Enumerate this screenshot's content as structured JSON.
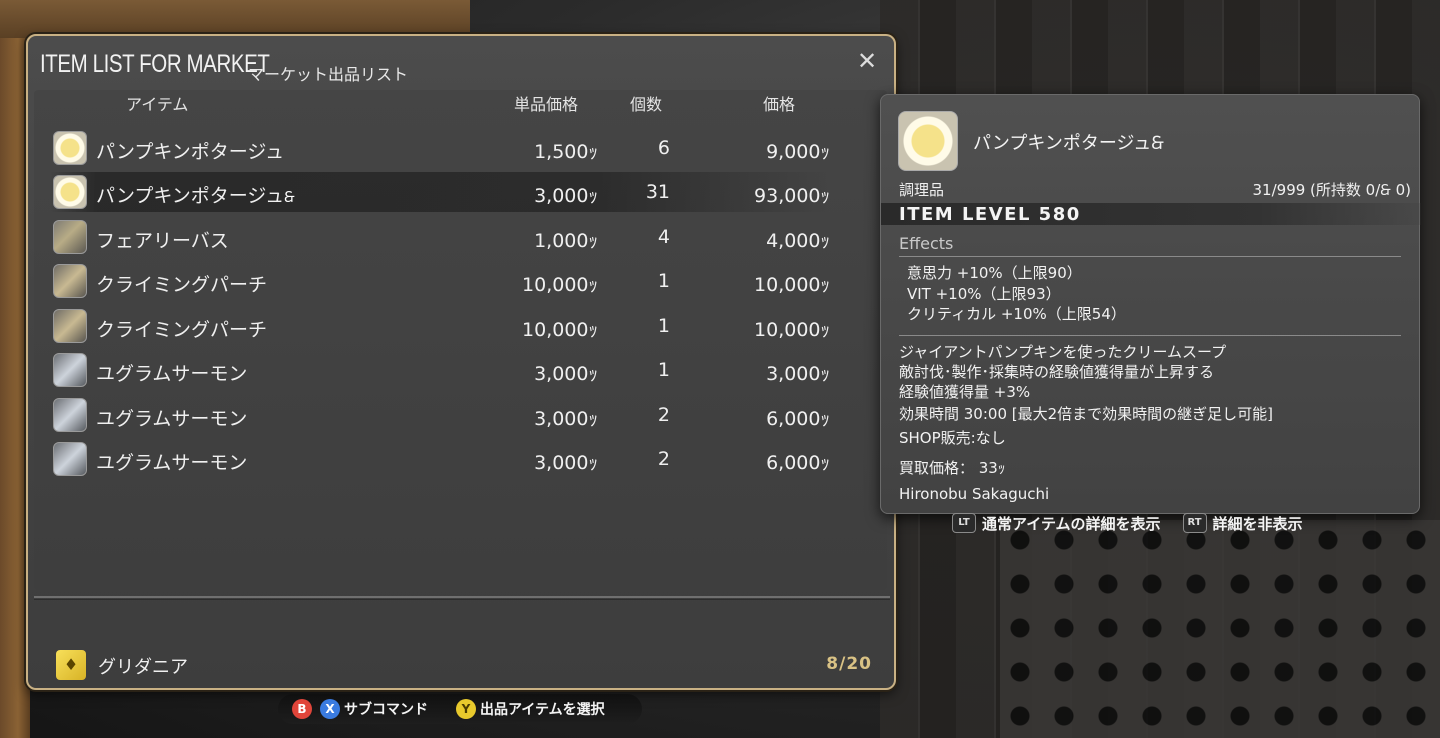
{
  "window": {
    "title_en": "ITEM LIST FOR MARKET",
    "title_jp": "マーケット出品リスト",
    "close_glyph": "✕"
  },
  "columns": {
    "item": "アイテム",
    "unit_price": "単品価格",
    "quantity": "個数",
    "price": "価格"
  },
  "items": [
    {
      "name": "パンプキンポタージュ",
      "hq": "",
      "unit_price": "1,500ｯ",
      "quantity": "6",
      "price": "9,000ｯ",
      "icon": "soup-icon"
    },
    {
      "name": "パンプキンポタージュ",
      "hq": "🙲",
      "unit_price": "3,000ｯ",
      "quantity": "31",
      "price": "93,000ｯ",
      "icon": "soup-icon"
    },
    {
      "name": "フェアリーバス",
      "hq": "",
      "unit_price": "1,000ｯ",
      "quantity": "4",
      "price": "4,000ｯ",
      "icon": "fish-icon"
    },
    {
      "name": "クライミングパーチ",
      "hq": "",
      "unit_price": "10,000ｯ",
      "quantity": "1",
      "price": "10,000ｯ",
      "icon": "fish-icon"
    },
    {
      "name": "クライミングパーチ",
      "hq": "",
      "unit_price": "10,000ｯ",
      "quantity": "1",
      "price": "10,000ｯ",
      "icon": "fish-icon"
    },
    {
      "name": "ユグラムサーモン",
      "hq": "",
      "unit_price": "3,000ｯ",
      "quantity": "1",
      "price": "3,000ｯ",
      "icon": "fish-icon"
    },
    {
      "name": "ユグラムサーモン",
      "hq": "",
      "unit_price": "3,000ｯ",
      "quantity": "2",
      "price": "6,000ｯ",
      "icon": "fish-icon"
    },
    {
      "name": "ユグラムサーモン",
      "hq": "",
      "unit_price": "3,000ｯ",
      "quantity": "2",
      "price": "6,000ｯ",
      "icon": "fish-icon"
    }
  ],
  "footer": {
    "city": "グリダニア",
    "capacity": "8/20"
  },
  "hints": {
    "b_key": "B",
    "x_key": "X",
    "subcommand": "サブコマンド",
    "y_key": "Y",
    "select_item": "出品アイテムを選択"
  },
  "tooltip": {
    "name": "パンプキンポタージュ",
    "hq": "🙲",
    "category": "調理品",
    "count": "31/999 (所持数 0/🙲 0)",
    "item_level": "ITEM LEVEL 580",
    "effects_title": "Effects",
    "effects": [
      "意思力 +10%（上限90）",
      "VIT +10%（上限93）",
      "クリティカル +10%（上限54）"
    ],
    "description": [
      "ジャイアントパンプキンを使ったクリームスープ",
      "敵討伐･製作･採集時の経験値獲得量が上昇する",
      "経験値獲得量 +3%",
      "効果時間 30:00 [最大2倍まで効果時間の継ぎ足し可能]",
      "SHOP販売:なし"
    ],
    "sell_price": "買取価格：  33ｯ",
    "crafter": "Hironobu Sakaguchi",
    "lt_key": "LT",
    "lt_label": "通常アイテムの詳細を表示",
    "rt_key": "RT",
    "rt_label": "詳細を非表示"
  },
  "colors": {
    "frame_gold": "#c9b184",
    "capacity_gold": "#d9c285",
    "button_b": "#e0453a",
    "button_x": "#3a7be0",
    "button_y": "#e8c92c"
  }
}
